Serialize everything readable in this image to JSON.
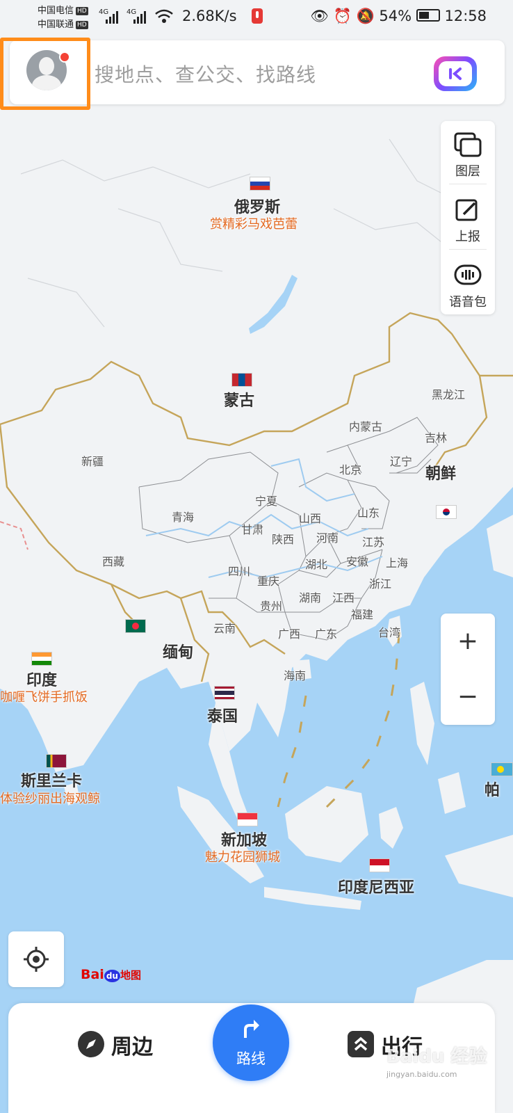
{
  "status_bar": {
    "carrier1": "中国电信",
    "carrier2": "中国联通",
    "hd": "HD",
    "sig": "4G",
    "network_speed": "2.68K/s",
    "battery": "54%",
    "time": "12:58"
  },
  "search": {
    "placeholder": "搜地点、查公交、找路线"
  },
  "tools": {
    "layers": "图层",
    "report": "上报",
    "voice_pack": "语音包"
  },
  "zoom": {
    "in": "+",
    "out": "−"
  },
  "logo": {
    "bai": "Bai",
    "du": "du",
    "suffix": "地图"
  },
  "bottom_bar": {
    "nearby": "周边",
    "route": "路线",
    "trip": "出行"
  },
  "watermark": {
    "text": "Baidu 经验",
    "url": "jingyan.baidu.com"
  },
  "map": {
    "countries": [
      {
        "name": "俄罗斯",
        "promo": "赏精彩马戏芭蕾"
      },
      {
        "name": "蒙古"
      },
      {
        "name": "朝鲜"
      },
      {
        "name": "缅甸"
      },
      {
        "name": "印度",
        "promo": "咖喱飞饼手抓饭"
      },
      {
        "name": "泰国"
      },
      {
        "name": "斯里兰卡",
        "promo": "体验纱丽出海观鲸"
      },
      {
        "name": "新加坡",
        "promo": "魅力花园狮城"
      },
      {
        "name": "印度尼西亚"
      },
      {
        "name": "帕"
      }
    ],
    "provinces": [
      "黑龙江",
      "吉林",
      "辽宁",
      "内蒙古",
      "北京",
      "新疆",
      "青海",
      "宁夏",
      "甘肃",
      "山西",
      "山东",
      "河南",
      "陕西",
      "江苏",
      "西藏",
      "四川",
      "重庆",
      "湖北",
      "安徽",
      "上海",
      "浙江",
      "贵州",
      "湖南",
      "江西",
      "福建",
      "云南",
      "广西",
      "广东",
      "台湾",
      "海南"
    ],
    "colors": {
      "sea": "#a6d3f6",
      "land": "#f1f3f5",
      "border": "#c5a55a",
      "accent": "#2f7df6",
      "promo": "#e46a22"
    }
  }
}
